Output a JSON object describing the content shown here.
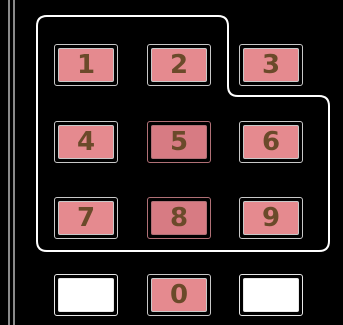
{
  "keypad": {
    "keys": {
      "1": "1",
      "2": "2",
      "3": "3",
      "4": "4",
      "5": "5",
      "6": "6",
      "7": "7",
      "8": "8",
      "9": "9",
      "0": "0",
      "blank_left": "",
      "blank_right": ""
    }
  },
  "colors": {
    "background": "#000000",
    "key_fill": "#e58a8f",
    "key_fill_active": "#d77b83",
    "key_text": "#6b4a2a",
    "outline": "#ffffff"
  }
}
